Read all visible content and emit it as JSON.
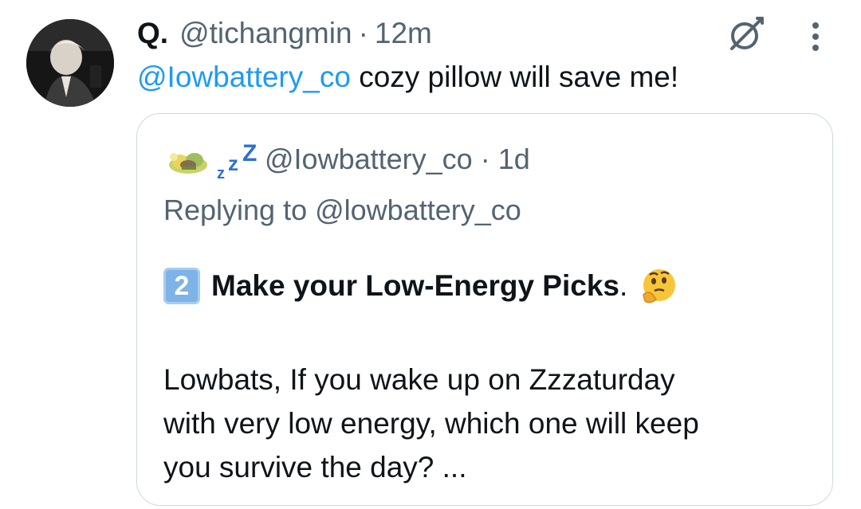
{
  "tweet": {
    "display_name": "Q.",
    "handle": "@tichangmin",
    "separator": "·",
    "time": "12m",
    "mention": "@Iowbattery_co",
    "text": " cozy pillow will save me!"
  },
  "quote": {
    "zzz_text": "zzZ",
    "handle": "@Iowbattery_co",
    "separator": "·",
    "time": "1d",
    "replying_to": "Replying to @lowbattery_co",
    "title_number": "2",
    "title_text": "Make your Low-Energy Picks",
    "title_period": ".",
    "body_lines": [
      "Lowbats, If you wake up on Zzzaturday",
      "with very low energy, which one will keep",
      "you survive the day? ..."
    ]
  },
  "icons": {
    "grok": "grok-icon",
    "more": "more-vertical-icon",
    "thinking": "thinking-face-emoji"
  },
  "colors": {
    "link": "#1d9bf0",
    "secondary": "#536471",
    "border": "#cfd9de",
    "text": "#0f1419"
  }
}
